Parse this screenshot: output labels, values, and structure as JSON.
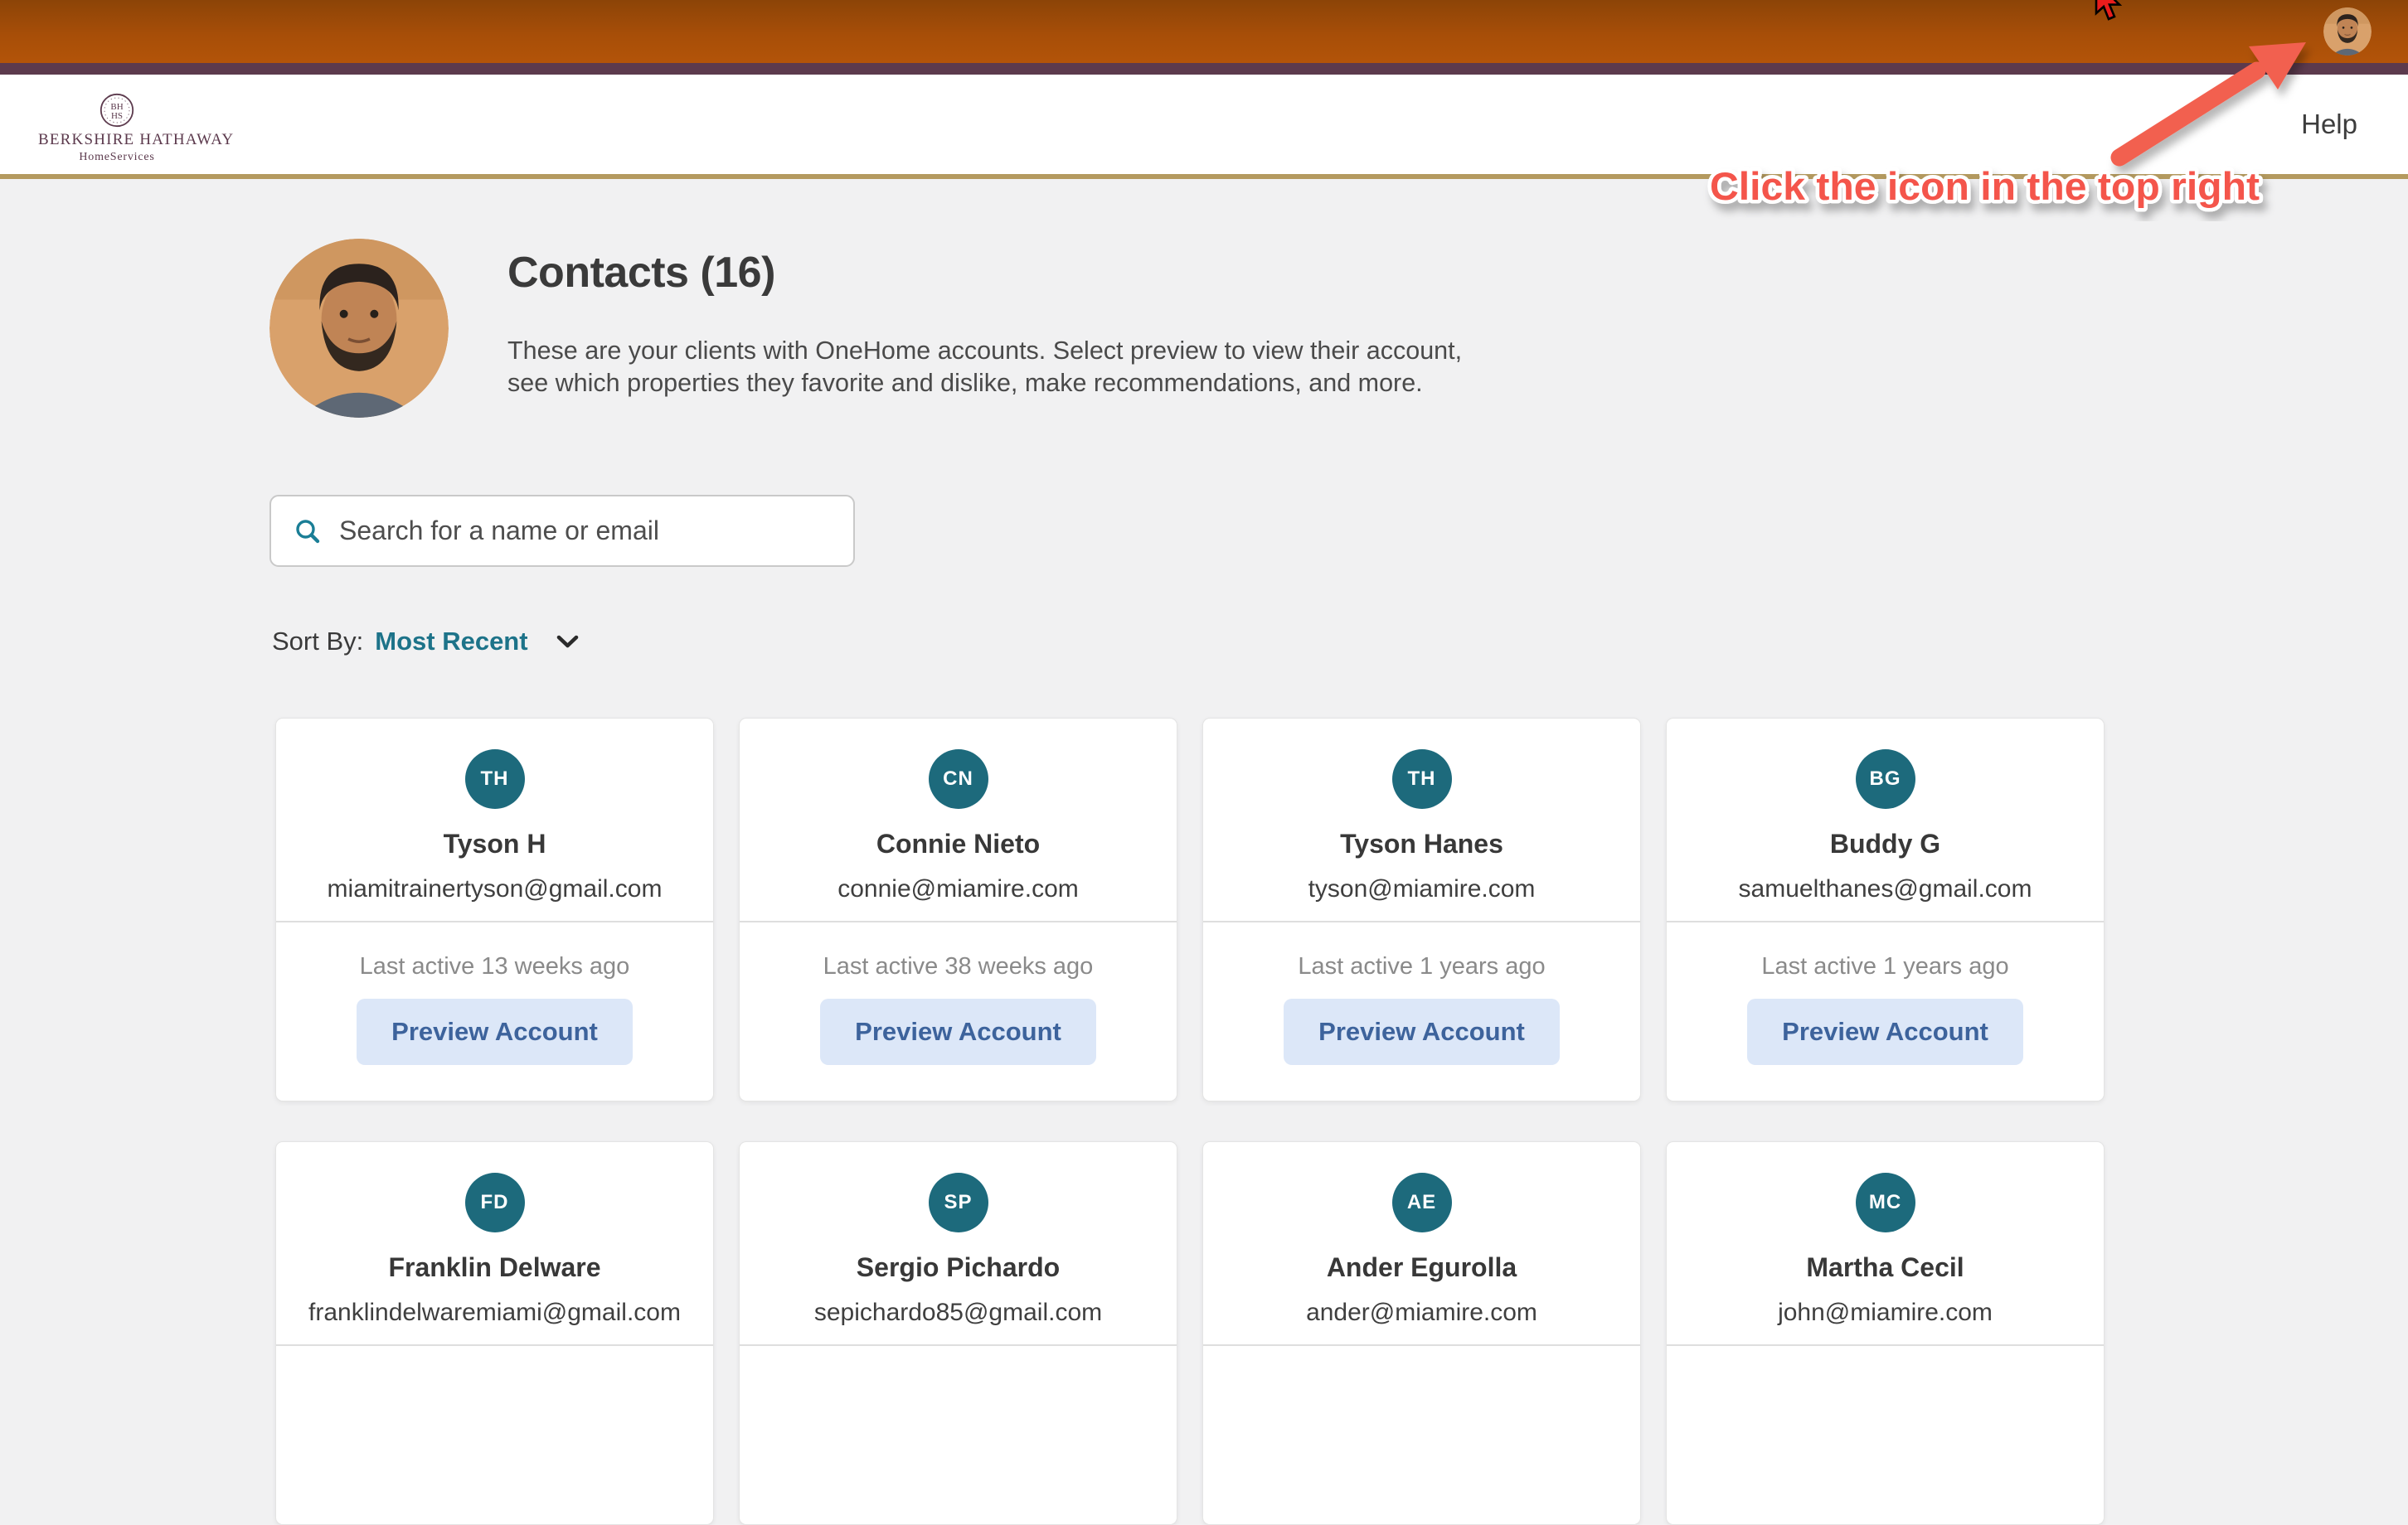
{
  "topbar": {
    "help_label": "Help"
  },
  "brand": {
    "emblem_line1": "BH",
    "emblem_line2": "HS",
    "name_line1": "BERKSHIRE HATHAWAY",
    "name_line2": "HomeServices"
  },
  "annotation": {
    "text": "Click the icon in the top right",
    "color": "#f4554b"
  },
  "page": {
    "title": "Contacts (16)",
    "description": "These are your clients with OneHome accounts. Select preview to view their account, see which properties they favorite and dislike, make recommendations, and more.",
    "search_placeholder": "Search for a name or email",
    "sort_label": "Sort By:",
    "sort_value": "Most Recent"
  },
  "contacts": [
    {
      "initials": "TH",
      "name": "Tyson H",
      "email": "miamitrainertyson@gmail.com",
      "last_active": "Last active 13 weeks ago",
      "action": "Preview Account"
    },
    {
      "initials": "CN",
      "name": "Connie Nieto",
      "email": "connie@miamire.com",
      "last_active": "Last active 38 weeks ago",
      "action": "Preview Account"
    },
    {
      "initials": "TH",
      "name": "Tyson Hanes",
      "email": "tyson@miamire.com",
      "last_active": "Last active 1 years ago",
      "action": "Preview Account"
    },
    {
      "initials": "BG",
      "name": "Buddy G",
      "email": "samuelthanes@gmail.com",
      "last_active": "Last active 1 years ago",
      "action": "Preview Account"
    },
    {
      "initials": "FD",
      "name": "Franklin Delware",
      "email": "franklindelwaremiami@gmail.com"
    },
    {
      "initials": "SP",
      "name": "Sergio Pichardo",
      "email": "sepichardo85@gmail.com"
    },
    {
      "initials": "AE",
      "name": "Ander Egurolla",
      "email": "ander@miamire.com"
    },
    {
      "initials": "MC",
      "name": "Martha Cecil",
      "email": "john@miamire.com"
    }
  ],
  "icons": {
    "search": "search-icon",
    "sort_chevron": "chevron-down-icon",
    "cursor": "cursor-icon",
    "profile": "profile-avatar-icon"
  },
  "colors": {
    "topbar_orange": "#a74e08",
    "brand_purple": "#5c3a4d",
    "header_gold": "#b49a5f",
    "page_bg": "#f1f1f2",
    "avatar_teal": "#1d6a7c",
    "sort_link_teal": "#1d7389",
    "preview_btn_bg": "#dce7f8",
    "preview_btn_text": "#3d639c",
    "annotation_red": "#f4554b"
  }
}
